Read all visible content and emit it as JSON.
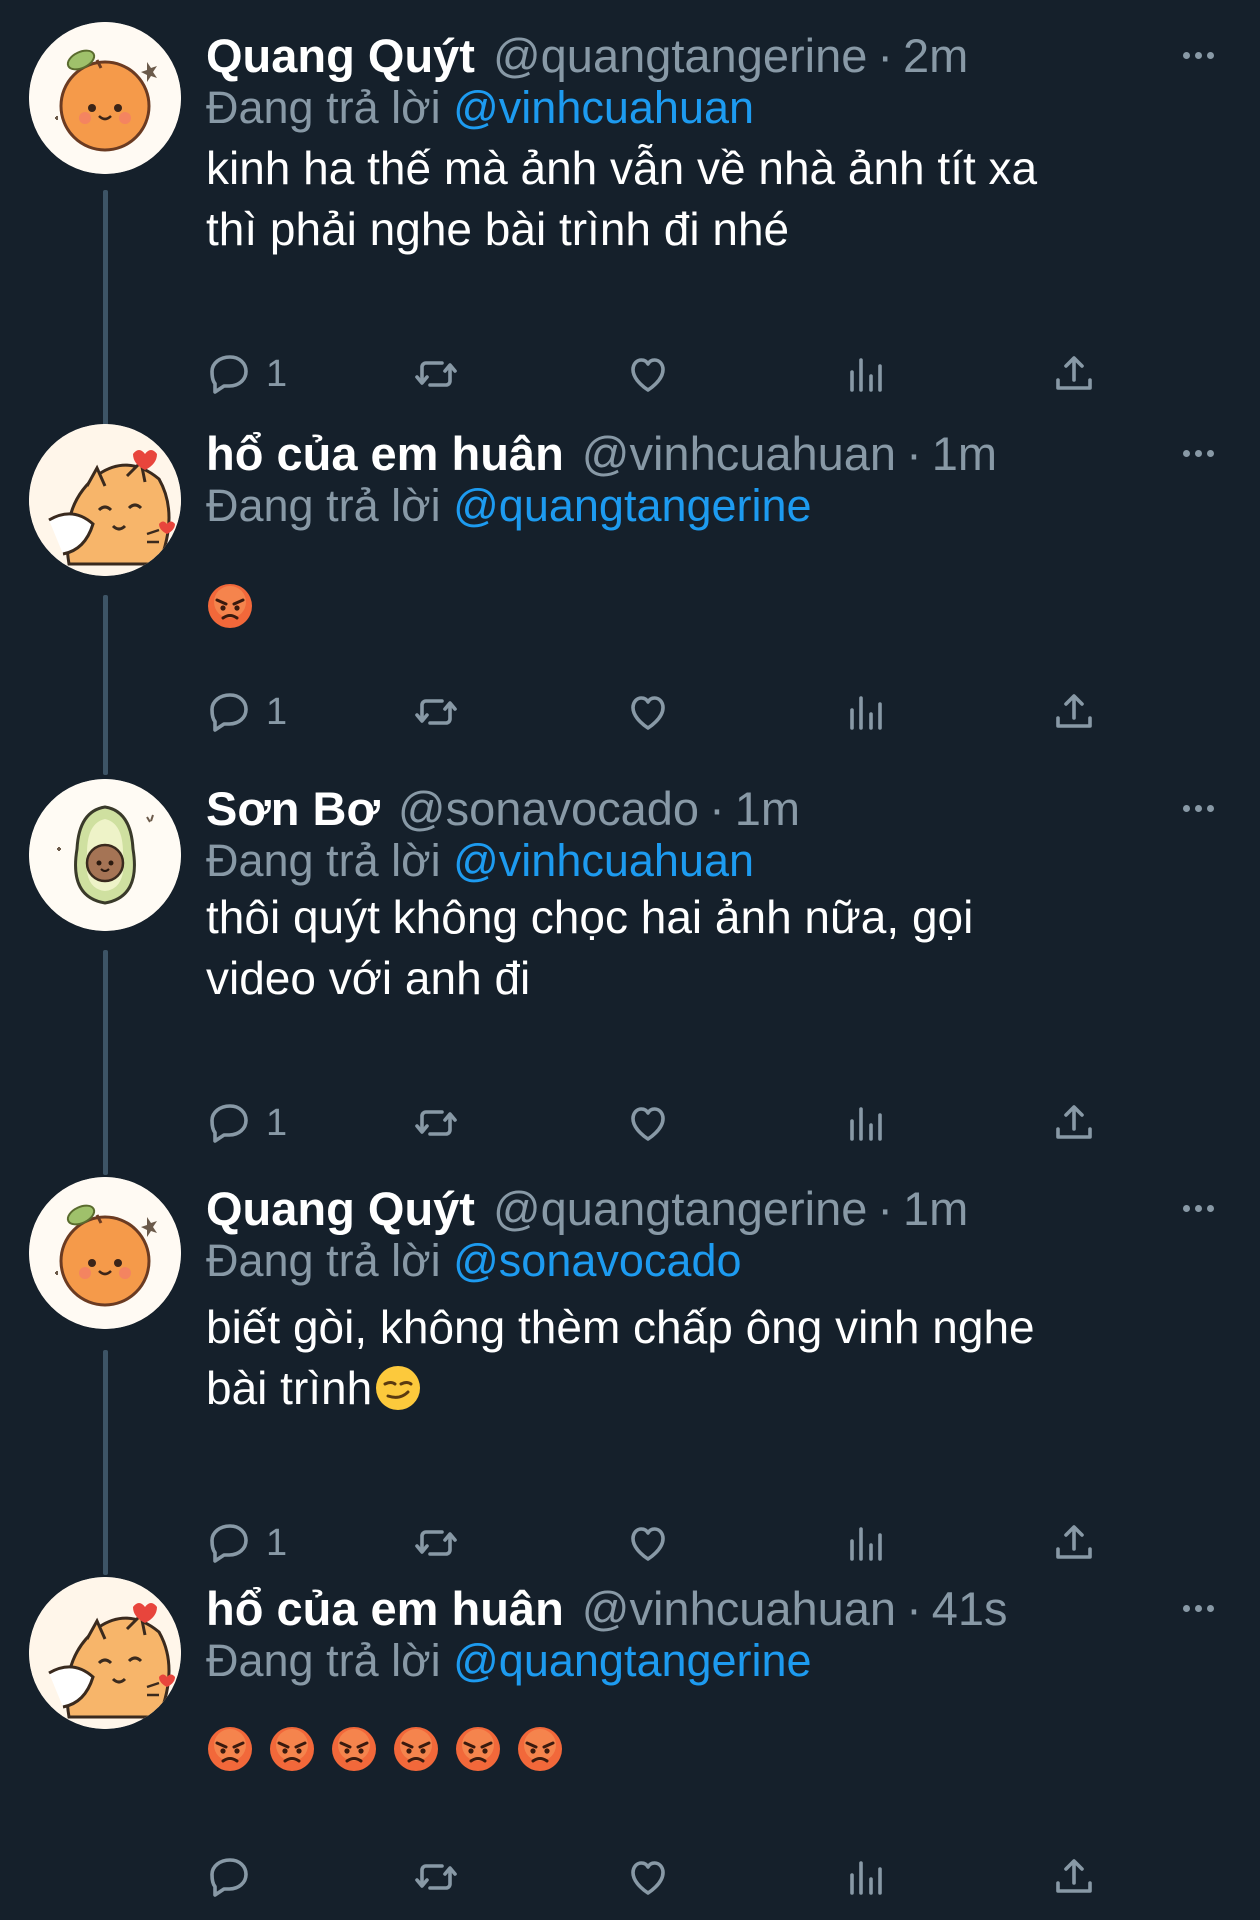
{
  "tweets": [
    {
      "name": "Quang Quýt",
      "handle": "@quangtangerine",
      "separator": "·",
      "time": "2m",
      "reply_prefix": "Đang trả lời",
      "reply_to": "@vinhcuahuan",
      "text_lines": [
        "kinh ha thế mà ảnh vẫn về nhà ảnh tít xa",
        "thì phải nghe bài trình đi nhé"
      ],
      "reply_count": "1",
      "avatar": "tangerine"
    },
    {
      "name": "hổ của em huân",
      "handle": "@vinhcuahuan",
      "separator": "·",
      "time": "1m",
      "reply_prefix": "Đang trả lời",
      "reply_to": "@quangtangerine",
      "emoji_count": 1,
      "emoji": "angry-face",
      "reply_count": "1",
      "avatar": "tiger-cat"
    },
    {
      "name": "Sơn Bơ",
      "handle": "@sonavocado",
      "separator": "·",
      "time": "1m",
      "reply_prefix": "Đang trả lời",
      "reply_to": "@vinhcuahuan",
      "text_lines": [
        "thôi quýt không chọc hai ảnh nữa, gọi",
        "video với anh đi"
      ],
      "reply_count": "1",
      "avatar": "avocado"
    },
    {
      "name": "Quang Quýt",
      "handle": "@quangtangerine",
      "separator": "·",
      "time": "1m",
      "reply_prefix": "Đang trả lời",
      "reply_to": "@sonavocado",
      "text_lines": [
        "biết gòi, không thèm chấp ông vinh nghe",
        "bài trình"
      ],
      "trailing_emoji": "smirking-face",
      "reply_count": "1",
      "avatar": "tangerine"
    },
    {
      "name": "hổ của em huân",
      "handle": "@vinhcuahuan",
      "separator": "·",
      "time": "41s",
      "reply_prefix": "Đang trả lời",
      "reply_to": "@quangtangerine",
      "emoji_count": 6,
      "emoji": "angry-face",
      "reply_count": "",
      "avatar": "tiger-cat"
    }
  ],
  "icons": {
    "reply": "comment-icon",
    "retweet": "retweet-icon",
    "like": "heart-icon",
    "stats": "analytics-icon",
    "share": "share-icon",
    "more": "more-options-icon"
  },
  "colors": {
    "background": "#15202b",
    "text": "#ffffff",
    "muted": "#8899a6",
    "link": "#1d9bf0",
    "thread_line": "#3d5466"
  }
}
